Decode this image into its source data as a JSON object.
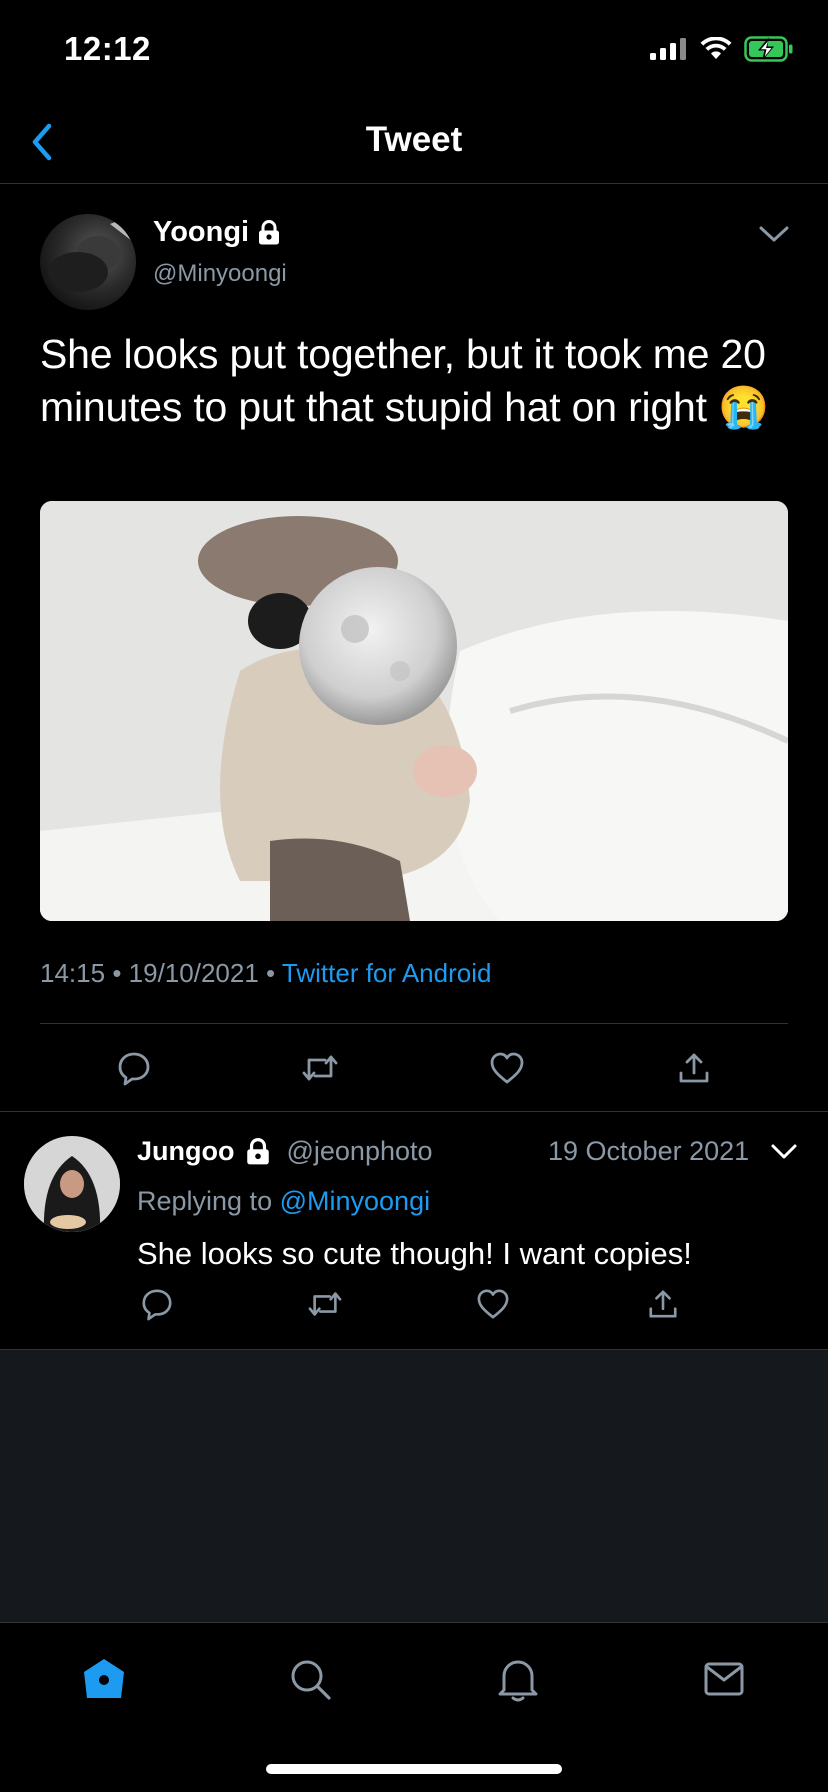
{
  "status_bar": {
    "time": "12:12"
  },
  "header": {
    "title": "Tweet"
  },
  "tweet": {
    "display_name": "Yoongi",
    "handle": "@Minyoongi",
    "text": "She looks put together, but it took me 20 minutes to put that stupid hat on right 😭",
    "time": "14:15",
    "date": "19/10/2021",
    "separator": "•",
    "source": "Twitter for Android"
  },
  "reply": {
    "display_name": "Jungoo",
    "handle": "@jeonphoto",
    "date": "19 October 2021",
    "replying_prefix": "Replying to",
    "replying_to": "@Minyoongi",
    "text": "She looks so cute though! I want copies!"
  },
  "icons": {
    "back": "chevron-left-icon",
    "more": "chevron-down-icon",
    "lock": "lock-icon",
    "reply": "comment-icon",
    "retweet": "retweet-icon",
    "like": "heart-icon",
    "share": "share-icon",
    "home": "home-icon",
    "search": "search-icon",
    "notifications": "bell-icon",
    "messages": "mail-icon"
  },
  "colors": {
    "background": "#000000",
    "accent": "#1d9bf0",
    "muted_text": "#8b98a5",
    "divider": "#2f3336",
    "battery": "#34c759"
  }
}
